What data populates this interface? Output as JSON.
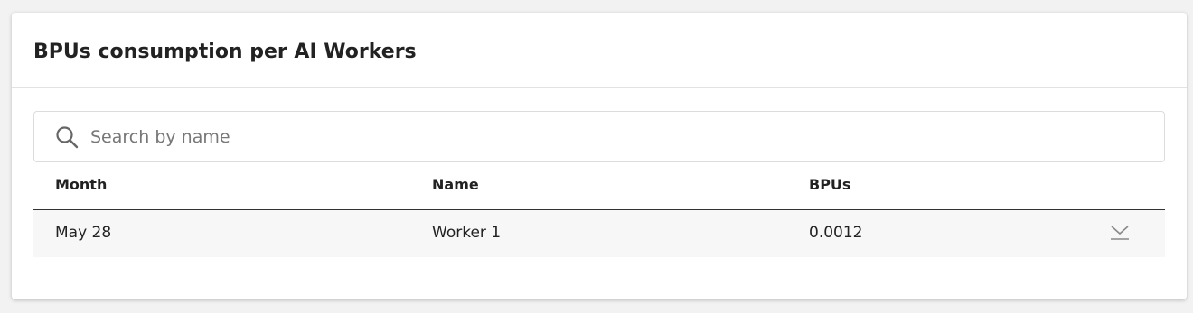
{
  "panel": {
    "title": "BPUs consumption per AI Workers"
  },
  "search": {
    "placeholder": "Search by name",
    "value": "",
    "icon": "search-icon"
  },
  "table": {
    "columns": [
      "Month",
      "Name",
      "BPUs"
    ],
    "rows": [
      {
        "month": "May 28",
        "name": "Worker 1",
        "bpus": "0.0012",
        "action_icon": "download-icon"
      }
    ]
  }
}
